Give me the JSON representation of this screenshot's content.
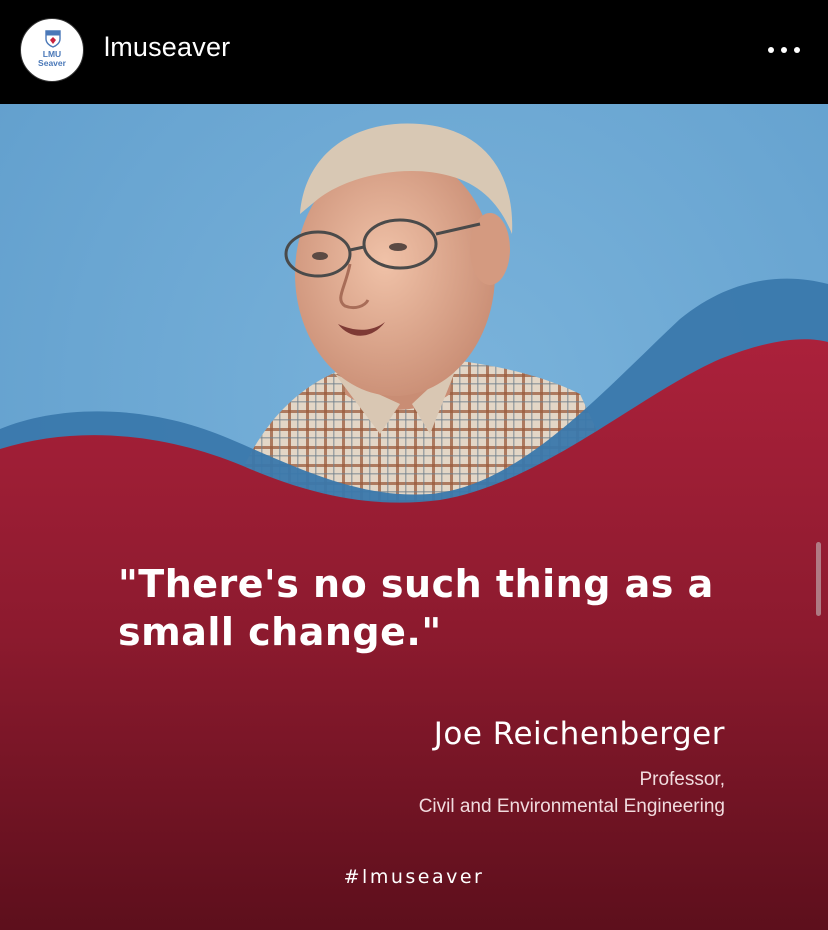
{
  "header": {
    "avatar": {
      "line1": "LMU",
      "line2": "Seaver",
      "brand_color": "#4a78b8"
    },
    "username": "lmuseaver",
    "more_icon": "more-horizontal-icon"
  },
  "post": {
    "quote": "\"There's no such thing as a small change.\"",
    "person_name": "Joe Reichenberger",
    "title_line1": "Professor,",
    "title_line2": "Civil and Environmental Engineering",
    "hashtag": "#lmuseaver",
    "colors": {
      "sky": "#6aa6d2",
      "wave_blue": "#3a78ac",
      "crimson_top": "#a8203a",
      "crimson_bottom": "#5e0f1d"
    }
  }
}
